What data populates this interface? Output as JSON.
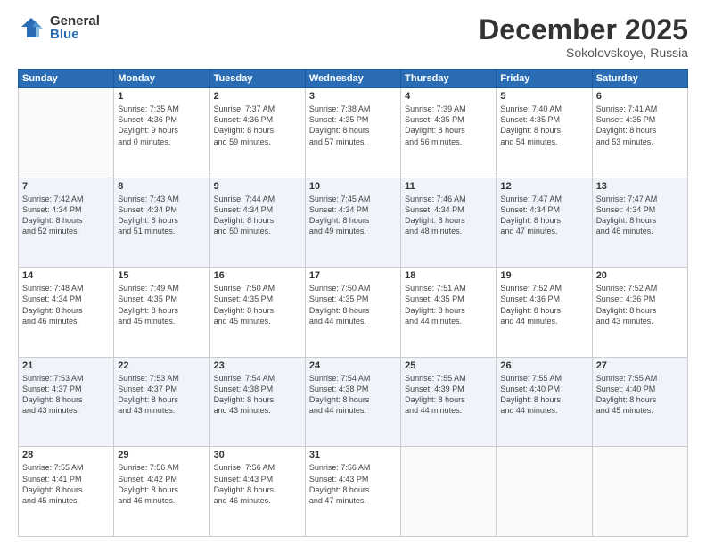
{
  "logo": {
    "general": "General",
    "blue": "Blue"
  },
  "title": "December 2025",
  "location": "Sokolovskoye, Russia",
  "days_header": [
    "Sunday",
    "Monday",
    "Tuesday",
    "Wednesday",
    "Thursday",
    "Friday",
    "Saturday"
  ],
  "weeks": [
    [
      {
        "day": "",
        "info": ""
      },
      {
        "day": "1",
        "info": "Sunrise: 7:35 AM\nSunset: 4:36 PM\nDaylight: 9 hours\nand 0 minutes."
      },
      {
        "day": "2",
        "info": "Sunrise: 7:37 AM\nSunset: 4:36 PM\nDaylight: 8 hours\nand 59 minutes."
      },
      {
        "day": "3",
        "info": "Sunrise: 7:38 AM\nSunset: 4:35 PM\nDaylight: 8 hours\nand 57 minutes."
      },
      {
        "day": "4",
        "info": "Sunrise: 7:39 AM\nSunset: 4:35 PM\nDaylight: 8 hours\nand 56 minutes."
      },
      {
        "day": "5",
        "info": "Sunrise: 7:40 AM\nSunset: 4:35 PM\nDaylight: 8 hours\nand 54 minutes."
      },
      {
        "day": "6",
        "info": "Sunrise: 7:41 AM\nSunset: 4:35 PM\nDaylight: 8 hours\nand 53 minutes."
      }
    ],
    [
      {
        "day": "7",
        "info": "Sunrise: 7:42 AM\nSunset: 4:34 PM\nDaylight: 8 hours\nand 52 minutes."
      },
      {
        "day": "8",
        "info": "Sunrise: 7:43 AM\nSunset: 4:34 PM\nDaylight: 8 hours\nand 51 minutes."
      },
      {
        "day": "9",
        "info": "Sunrise: 7:44 AM\nSunset: 4:34 PM\nDaylight: 8 hours\nand 50 minutes."
      },
      {
        "day": "10",
        "info": "Sunrise: 7:45 AM\nSunset: 4:34 PM\nDaylight: 8 hours\nand 49 minutes."
      },
      {
        "day": "11",
        "info": "Sunrise: 7:46 AM\nSunset: 4:34 PM\nDaylight: 8 hours\nand 48 minutes."
      },
      {
        "day": "12",
        "info": "Sunrise: 7:47 AM\nSunset: 4:34 PM\nDaylight: 8 hours\nand 47 minutes."
      },
      {
        "day": "13",
        "info": "Sunrise: 7:47 AM\nSunset: 4:34 PM\nDaylight: 8 hours\nand 46 minutes."
      }
    ],
    [
      {
        "day": "14",
        "info": "Sunrise: 7:48 AM\nSunset: 4:34 PM\nDaylight: 8 hours\nand 46 minutes."
      },
      {
        "day": "15",
        "info": "Sunrise: 7:49 AM\nSunset: 4:35 PM\nDaylight: 8 hours\nand 45 minutes."
      },
      {
        "day": "16",
        "info": "Sunrise: 7:50 AM\nSunset: 4:35 PM\nDaylight: 8 hours\nand 45 minutes."
      },
      {
        "day": "17",
        "info": "Sunrise: 7:50 AM\nSunset: 4:35 PM\nDaylight: 8 hours\nand 44 minutes."
      },
      {
        "day": "18",
        "info": "Sunrise: 7:51 AM\nSunset: 4:35 PM\nDaylight: 8 hours\nand 44 minutes."
      },
      {
        "day": "19",
        "info": "Sunrise: 7:52 AM\nSunset: 4:36 PM\nDaylight: 8 hours\nand 44 minutes."
      },
      {
        "day": "20",
        "info": "Sunrise: 7:52 AM\nSunset: 4:36 PM\nDaylight: 8 hours\nand 43 minutes."
      }
    ],
    [
      {
        "day": "21",
        "info": "Sunrise: 7:53 AM\nSunset: 4:37 PM\nDaylight: 8 hours\nand 43 minutes."
      },
      {
        "day": "22",
        "info": "Sunrise: 7:53 AM\nSunset: 4:37 PM\nDaylight: 8 hours\nand 43 minutes."
      },
      {
        "day": "23",
        "info": "Sunrise: 7:54 AM\nSunset: 4:38 PM\nDaylight: 8 hours\nand 43 minutes."
      },
      {
        "day": "24",
        "info": "Sunrise: 7:54 AM\nSunset: 4:38 PM\nDaylight: 8 hours\nand 44 minutes."
      },
      {
        "day": "25",
        "info": "Sunrise: 7:55 AM\nSunset: 4:39 PM\nDaylight: 8 hours\nand 44 minutes."
      },
      {
        "day": "26",
        "info": "Sunrise: 7:55 AM\nSunset: 4:40 PM\nDaylight: 8 hours\nand 44 minutes."
      },
      {
        "day": "27",
        "info": "Sunrise: 7:55 AM\nSunset: 4:40 PM\nDaylight: 8 hours\nand 45 minutes."
      }
    ],
    [
      {
        "day": "28",
        "info": "Sunrise: 7:55 AM\nSunset: 4:41 PM\nDaylight: 8 hours\nand 45 minutes."
      },
      {
        "day": "29",
        "info": "Sunrise: 7:56 AM\nSunset: 4:42 PM\nDaylight: 8 hours\nand 46 minutes."
      },
      {
        "day": "30",
        "info": "Sunrise: 7:56 AM\nSunset: 4:43 PM\nDaylight: 8 hours\nand 46 minutes."
      },
      {
        "day": "31",
        "info": "Sunrise: 7:56 AM\nSunset: 4:43 PM\nDaylight: 8 hours\nand 47 minutes."
      },
      {
        "day": "",
        "info": ""
      },
      {
        "day": "",
        "info": ""
      },
      {
        "day": "",
        "info": ""
      }
    ]
  ]
}
